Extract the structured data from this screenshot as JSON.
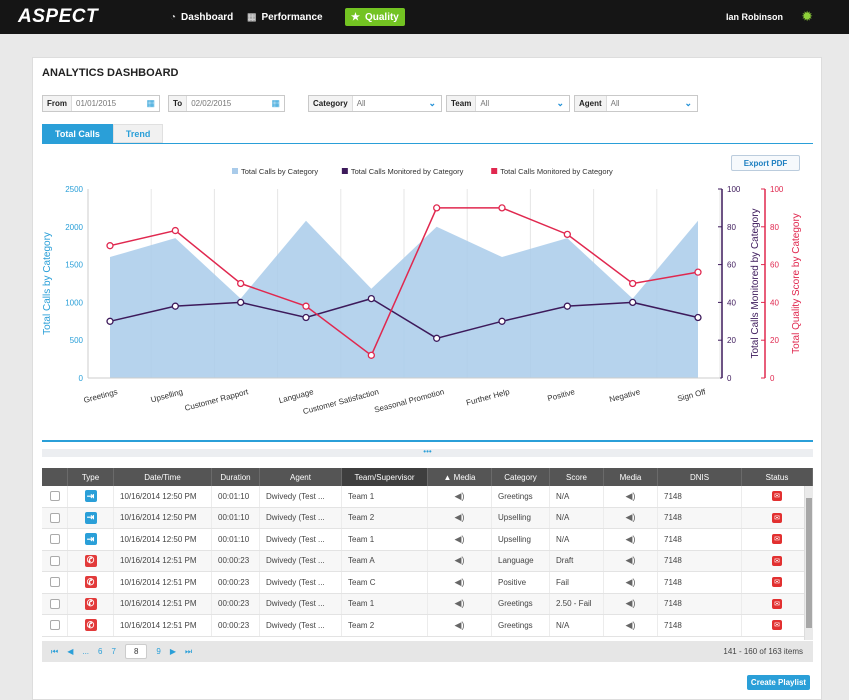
{
  "app": {
    "logo": "ASPECT",
    "nav": [
      {
        "label": "Dashboard",
        "icon": "speedometer-icon"
      },
      {
        "label": "Performance",
        "icon": "chart-icon"
      },
      {
        "label": "Quality",
        "icon": "star-icon"
      }
    ],
    "user": "Ian Robinson"
  },
  "page": {
    "title": "ANALYTICS DASHBOARD",
    "filters": {
      "from_label": "From",
      "from_value": "01/01/2015",
      "to_label": "To",
      "to_value": "02/02/2015",
      "category_label": "Category",
      "category_value": "All",
      "team_label": "Team",
      "team_value": "All",
      "agent_label": "Agent",
      "agent_value": "All"
    },
    "tabs": [
      "Total Calls",
      "Trend"
    ],
    "export_label": "Export PDF",
    "dots": "•••",
    "create_playlist": "Create Playlist"
  },
  "chart_data": {
    "type": "area",
    "categories": [
      "Greetings",
      "Upselling",
      "Customer Rapport",
      "Language",
      "Customer Satisfaction",
      "Seasonal Promotion",
      "Further Help",
      "Positive",
      "Negative",
      "Sign Off"
    ],
    "series": [
      {
        "name": "Total Calls by Category",
        "type": "area",
        "axis": "left",
        "color": "#a9cbea",
        "values": [
          1600,
          1850,
          1050,
          2080,
          1180,
          2000,
          1600,
          1850,
          1050,
          2080
        ]
      },
      {
        "name": "Total Calls Monitored by Category",
        "type": "line",
        "axis": "right1",
        "color": "#3d1a5b",
        "values": [
          30,
          38,
          40,
          32,
          42,
          21,
          30,
          38,
          40,
          32
        ]
      },
      {
        "name": "Total Calls Monitored by Category",
        "type": "line",
        "axis": "right2",
        "color": "#e0284f",
        "values": [
          70,
          78,
          50,
          38,
          12,
          90,
          90,
          76,
          50,
          56
        ]
      }
    ],
    "ylabel": "Total Calls by Category",
    "ylabel_right1": "Total Calls Monitored by Category",
    "ylabel_right2": "Total Quality Score by Category",
    "ylim": [
      0,
      2500
    ],
    "yticks": [
      "0",
      "500",
      "1000",
      "1500",
      "2000",
      "2500"
    ],
    "ylim_right": [
      0,
      100
    ],
    "yticks_right": [
      "0",
      "20",
      "40",
      "60",
      "80",
      "100"
    ],
    "legend_position": "top",
    "grid": "vertical"
  },
  "table": {
    "headers": [
      "Type",
      "Date/Time",
      "Duration",
      "Agent",
      "Team/Supervisor",
      "▲ Media",
      "Category",
      "Score",
      "Media",
      "DNIS",
      "Status"
    ],
    "rows": [
      {
        "type": "inbound",
        "datetime": "10/16/2014 12:50 PM",
        "duration": "00:01:10",
        "agent": "Dwivedy (Test ...",
        "team": "Team 1",
        "category": "Greetings",
        "score": "N/A",
        "dnis": "7148"
      },
      {
        "type": "inbound",
        "datetime": "10/16/2014 12:50 PM",
        "duration": "00:01:10",
        "agent": "Dwivedy (Test ...",
        "team": "Team 2",
        "category": "Upselling",
        "score": "N/A",
        "dnis": "7148"
      },
      {
        "type": "inbound",
        "datetime": "10/16/2014 12:50 PM",
        "duration": "00:01:10",
        "agent": "Dwivedy (Test ...",
        "team": "Team 1",
        "category": "Upselling",
        "score": "N/A",
        "dnis": "7148"
      },
      {
        "type": "outbound",
        "datetime": "10/16/2014 12:51 PM",
        "duration": "00:00:23",
        "agent": "Dwivedy (Test ...",
        "team": "Team A",
        "category": "Language",
        "score": "Draft",
        "dnis": "7148"
      },
      {
        "type": "outbound",
        "datetime": "10/16/2014 12:51 PM",
        "duration": "00:00:23",
        "agent": "Dwivedy (Test ...",
        "team": "Team C",
        "category": "Positive",
        "score": "Fail",
        "dnis": "7148"
      },
      {
        "type": "outbound",
        "datetime": "10/16/2014 12:51 PM",
        "duration": "00:00:23",
        "agent": "Dwivedy (Test ...",
        "team": "Team 1",
        "category": "Greetings",
        "score": "2.50 - Fail",
        "dnis": "7148"
      },
      {
        "type": "outbound",
        "datetime": "10/16/2014 12:51 PM",
        "duration": "00:00:23",
        "agent": "Dwivedy (Test ...",
        "team": "Team 2",
        "category": "Greetings",
        "score": "N/A",
        "dnis": "7148"
      }
    ]
  },
  "pager": {
    "pages": [
      "...",
      "6",
      "7",
      "8",
      "9"
    ],
    "current": "8",
    "info": "141 - 160 of 163 items"
  }
}
